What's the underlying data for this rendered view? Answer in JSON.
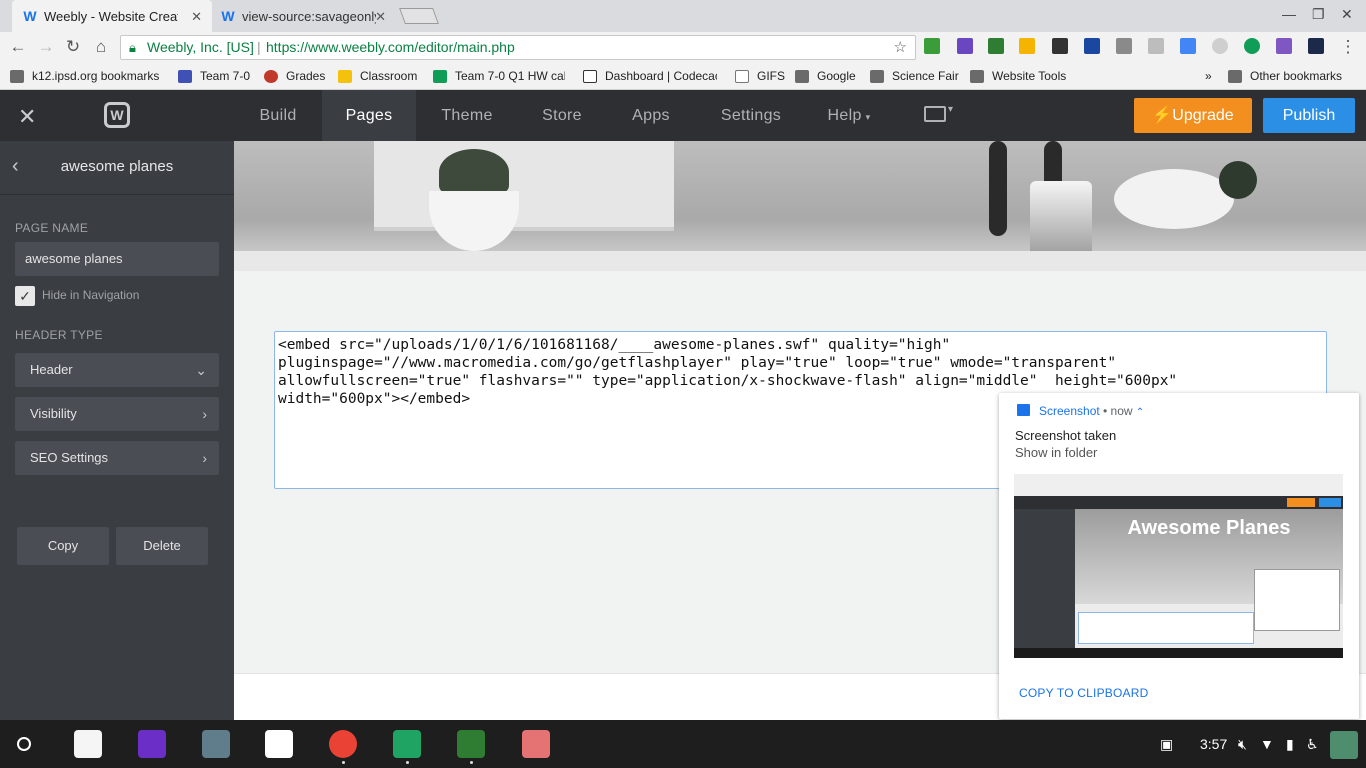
{
  "browser": {
    "tabs": [
      {
        "title": "Weebly - Website Creatio",
        "active": true
      },
      {
        "title": "view-source:savageonly.",
        "active": false
      }
    ],
    "address": {
      "org": "Weebly, Inc. [US]",
      "url": "https://www.weebly.com/editor/main.php"
    },
    "bookmarks": [
      "k12.ipsd.org bookmarks",
      "Team 7-0",
      "Grades",
      "Classroom",
      "Team 7-0 Q1 HW cal",
      "Dashboard | Codecac",
      "GIFS",
      "Google",
      "Science Fair",
      "Website Tools",
      "Other bookmarks"
    ],
    "overflow": "»"
  },
  "editor": {
    "nav": [
      "Build",
      "Pages",
      "Theme",
      "Store",
      "Apps",
      "Settings",
      "Help"
    ],
    "active_nav": "Pages",
    "upgrade_label": "Upgrade",
    "publish_label": "Publish"
  },
  "sidebar": {
    "page_title": "awesome planes",
    "page_name_label": "PAGE NAME",
    "page_name_value": "awesome planes",
    "hide_in_nav_label": "Hide in Navigation",
    "hide_in_nav_checked": true,
    "header_type_label": "HEADER TYPE",
    "header_type_value": "Header",
    "visibility_label": "Visibility",
    "seo_label": "SEO Settings",
    "copy_label": "Copy",
    "delete_label": "Delete"
  },
  "canvas": {
    "embed_code": "<embed src=\"/uploads/1/0/1/6/101681168/____awesome-planes.swf\" quality=\"high\"\npluginspage=\"//www.macromedia.com/go/getflashplayer\" play=\"true\" loop=\"true\" wmode=\"transparent\"\nallowfullscreen=\"true\" flashvars=\"\" type=\"application/x-shockwave-flash\" align=\"middle\"  height=\"600px\"\nwidth=\"600px\"></embed>"
  },
  "notification": {
    "app": "Screenshot",
    "time": "now",
    "heading": "Screenshot taken",
    "subtext": "Show in folder",
    "thumbnail_title": "Awesome Planes",
    "action": "COPY TO CLIPBOARD"
  },
  "shelf": {
    "clock": "3:57"
  },
  "colors": {
    "upgrade": "#f28f1f",
    "publish": "#2b8fe6",
    "sidebar": "#3a3d42",
    "topbar": "#2d2f33"
  }
}
